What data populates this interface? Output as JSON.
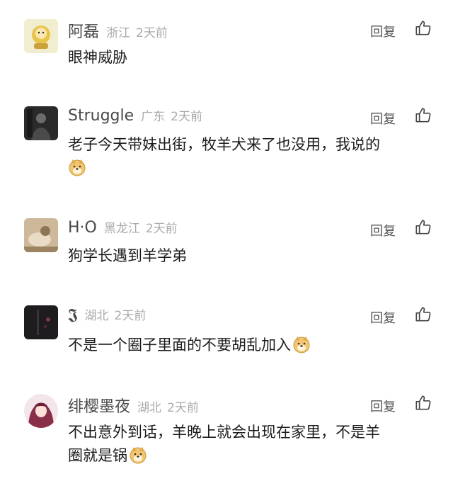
{
  "comments": [
    {
      "username": "阿磊",
      "location": "浙江",
      "time": "2天前",
      "text": "眼神威胁",
      "text2": "",
      "reply_label": "回复",
      "emoji": ""
    },
    {
      "username": "Struggle",
      "location": "广东",
      "time": "2天前",
      "text": "老子今天带妹出街，牧羊犬来了也没用，我说的",
      "text2": "",
      "reply_label": "回复",
      "emoji": "doge-emoji"
    },
    {
      "username": "H·O",
      "location": "黑龙江",
      "time": "2天前",
      "text": "狗学长遇到羊学弟",
      "text2": "",
      "reply_label": "回复",
      "emoji": ""
    },
    {
      "username": "𝕵",
      "location": "湖北",
      "time": "2天前",
      "text": "不是一个圈子里面的不要胡乱加入",
      "text2": "",
      "reply_label": "回复",
      "emoji": "doge-emoji"
    },
    {
      "username": "绯樱墨夜",
      "location": "湖北",
      "time": "2天前",
      "text": "不出意外到话，羊晚上就会出现在家里，不是羊",
      "text2": "圈就是锅",
      "reply_label": "回复",
      "emoji": "doge-emoji"
    }
  ],
  "icons": {
    "like": "thumbs-up-icon",
    "emoji": "doge-emoji"
  },
  "colors": {
    "username": "#4a4a4a",
    "meta": "#aaaaaa",
    "text": "#1c1c1c",
    "action": "#555555"
  }
}
